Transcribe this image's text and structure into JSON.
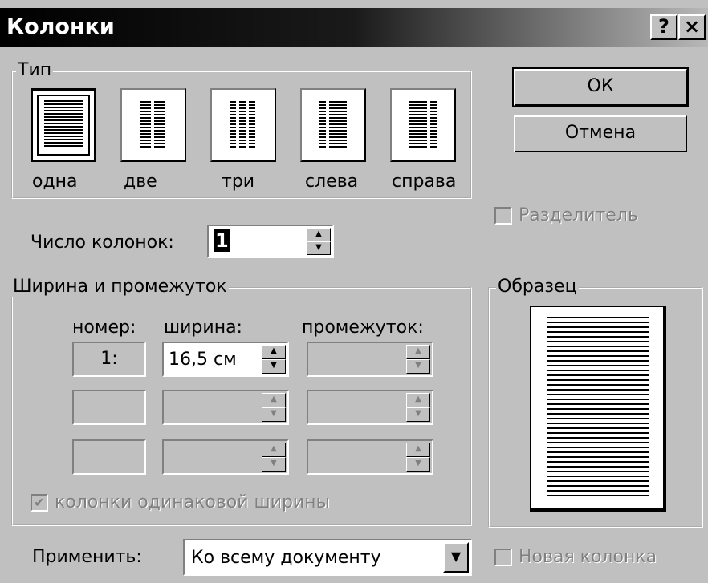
{
  "window": {
    "title": "Колонки",
    "help_button": "?",
    "close_button": "×"
  },
  "type_group": {
    "legend": "Тип",
    "options": [
      {
        "label": "одна"
      },
      {
        "label": "две"
      },
      {
        "label": "три"
      },
      {
        "label": "слева"
      },
      {
        "label": "справа"
      }
    ]
  },
  "buttons": {
    "ok": "ОК",
    "cancel": "Отмена"
  },
  "separator": {
    "label": "Разделитель",
    "checked": false,
    "enabled": false
  },
  "num_columns": {
    "label": "Число колонок:",
    "value": "1"
  },
  "width_group": {
    "legend": "Ширина и промежуток",
    "headers": {
      "number": "номер:",
      "width": "ширина:",
      "spacing": "промежуток:"
    },
    "rows": [
      {
        "number": "1:",
        "width": "16,5 см",
        "spacing": ""
      },
      {
        "number": "",
        "width": "",
        "spacing": ""
      },
      {
        "number": "",
        "width": "",
        "spacing": ""
      }
    ],
    "equal_width": {
      "label": "колонки одинаковой ширины",
      "checked": true,
      "enabled": false
    }
  },
  "preview": {
    "legend": "Образец"
  },
  "apply": {
    "label": "Применить:",
    "value": "Ко всему документу"
  },
  "new_column": {
    "label": "Новая колонка",
    "checked": false,
    "enabled": false
  },
  "spin_up": "▲",
  "spin_down": "▼",
  "dropdown_arrow": "▼",
  "check_mark": "✔"
}
